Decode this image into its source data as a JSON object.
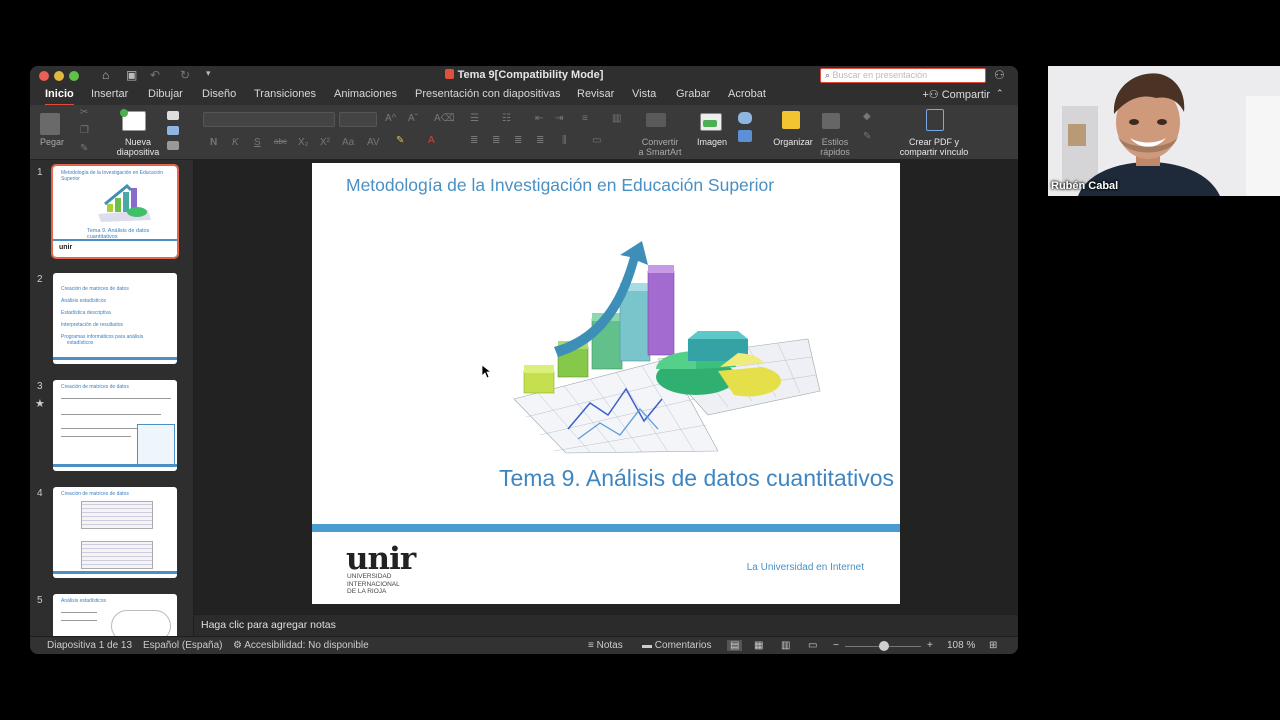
{
  "window": {
    "title": "Tema 9[Compatibility Mode]",
    "search_placeholder": "Buscar en presentación",
    "share_label": "Compartir"
  },
  "tabs": [
    {
      "label": "Inicio",
      "active": true
    },
    {
      "label": "Insertar"
    },
    {
      "label": "Dibujar"
    },
    {
      "label": "Diseño"
    },
    {
      "label": "Transiciones"
    },
    {
      "label": "Animaciones"
    },
    {
      "label": "Presentación con diapositivas"
    },
    {
      "label": "Revisar"
    },
    {
      "label": "Vista"
    },
    {
      "label": "Grabar"
    },
    {
      "label": "Acrobat"
    }
  ],
  "ribbon": {
    "paste": "Pegar",
    "new_slide_1": "Nueva",
    "new_slide_2": "diapositiva",
    "smartart_1": "Convertir",
    "smartart_2": "a SmartArt",
    "image": "Imagen",
    "arrange": "Organizar",
    "styles_1": "Estilos",
    "styles_2": "rápidos",
    "pdf_1": "Crear PDF y",
    "pdf_2": "compartir vínculo"
  },
  "thumbnails": {
    "slide1": {
      "number": "1",
      "title": "Metodología de la Investigación en Educación Superior",
      "subtitle": "Tema 9. Análisis de datos cuantitativos",
      "logo": "unir"
    },
    "slide2": {
      "number": "2",
      "items": [
        "Creación de matrices de datos",
        "Análisis estadísticos",
        "Estadística descriptiva",
        "Interpretación de resultados",
        "Programas informáticos para análisis",
        "estadísticos"
      ]
    },
    "slide3": {
      "number": "3",
      "title": "Creación de matrices de datos"
    },
    "slide4": {
      "number": "4",
      "title": "Creación de matrices de datos"
    },
    "slide5": {
      "number": "5",
      "title": "Análisis estadísticos"
    }
  },
  "slide": {
    "title": "Metodología de la Investigación en Educación Superior",
    "subtitle": "Tema 9. Análisis de datos cuantitativos",
    "logo": "unir",
    "logo_sub_1": "UNIVERSIDAD",
    "logo_sub_2": "INTERNACIONAL",
    "logo_sub_3": "DE LA RIOJA",
    "tagline": "La Universidad en Internet"
  },
  "notes_placeholder": "Haga clic para agregar notas",
  "status": {
    "slide_count": "Diapositiva 1 de 13",
    "language": "Español (España)",
    "accessibility": "Accesibilidad: No disponible",
    "notes": "Notas",
    "comments": "Comentarios",
    "zoom": "108 %"
  },
  "participant": {
    "name": "Rubén Cabal"
  },
  "colors": {
    "accent": "#e24a3b",
    "slide_blue": "#4a90c2"
  }
}
